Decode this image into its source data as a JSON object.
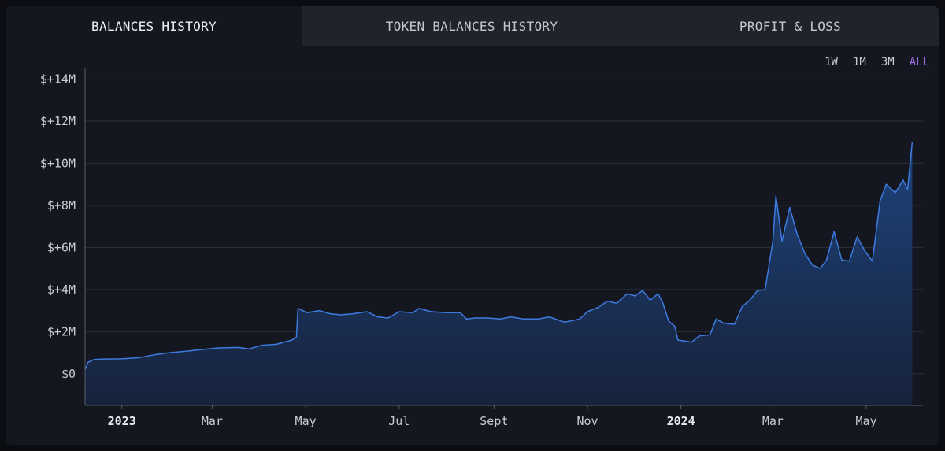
{
  "tabs": [
    {
      "label": "BALANCES HISTORY",
      "active": true
    },
    {
      "label": "TOKEN BALANCES HISTORY",
      "active": false
    },
    {
      "label": "PROFIT & LOSS",
      "active": false
    }
  ],
  "ranges": [
    {
      "label": "1W",
      "selected": false
    },
    {
      "label": "1M",
      "selected": false
    },
    {
      "label": "3M",
      "selected": false
    },
    {
      "label": "ALL",
      "selected": true
    }
  ],
  "colors": {
    "line": "#3d7be0",
    "fill_top": "#1f4680",
    "fill_bottom": "#17233d",
    "accent": "#9a6fe0"
  },
  "chart_data": {
    "type": "area",
    "title": "",
    "xlabel": "",
    "ylabel": "",
    "ylim": [
      -1500000,
      14500000
    ],
    "xlim": [
      "2022-12-08",
      "2024-06-07"
    ],
    "grid": true,
    "y_ticks": [
      {
        "value": 0,
        "label": "$0"
      },
      {
        "value": 2000000,
        "label": "$+2M"
      },
      {
        "value": 4000000,
        "label": "$+4M"
      },
      {
        "value": 6000000,
        "label": "$+6M"
      },
      {
        "value": 8000000,
        "label": "$+8M"
      },
      {
        "value": 10000000,
        "label": "$+10M"
      },
      {
        "value": 12000000,
        "label": "$+12M"
      },
      {
        "value": 14000000,
        "label": "$+14M"
      }
    ],
    "x_ticks": [
      {
        "date": "2023-01-01",
        "label": "2023",
        "bold": true
      },
      {
        "date": "2023-03-01",
        "label": "Mar",
        "bold": false
      },
      {
        "date": "2023-05-01",
        "label": "May",
        "bold": false
      },
      {
        "date": "2023-07-01",
        "label": "Jul",
        "bold": false
      },
      {
        "date": "2023-09-01",
        "label": "Sept",
        "bold": false
      },
      {
        "date": "2023-11-01",
        "label": "Nov",
        "bold": false
      },
      {
        "date": "2024-01-01",
        "label": "2024",
        "bold": true
      },
      {
        "date": "2024-03-01",
        "label": "Mar",
        "bold": false
      },
      {
        "date": "2024-05-01",
        "label": "May",
        "bold": false
      }
    ],
    "series": [
      {
        "points": [
          [
            "2022-12-08",
            200000
          ],
          [
            "2022-12-10",
            550000
          ],
          [
            "2022-12-14",
            680000
          ],
          [
            "2022-12-22",
            700000
          ],
          [
            "2023-01-01",
            710000
          ],
          [
            "2023-01-12",
            760000
          ],
          [
            "2023-01-22",
            900000
          ],
          [
            "2023-02-01",
            1000000
          ],
          [
            "2023-02-12",
            1070000
          ],
          [
            "2023-02-22",
            1150000
          ],
          [
            "2023-03-05",
            1230000
          ],
          [
            "2023-03-18",
            1250000
          ],
          [
            "2023-03-25",
            1180000
          ],
          [
            "2023-04-02",
            1350000
          ],
          [
            "2023-04-12",
            1400000
          ],
          [
            "2023-04-22",
            1600000
          ],
          [
            "2023-04-25",
            1750000
          ],
          [
            "2023-04-26",
            3100000
          ],
          [
            "2023-05-02",
            2900000
          ],
          [
            "2023-05-10",
            3000000
          ],
          [
            "2023-05-17",
            2850000
          ],
          [
            "2023-05-24",
            2800000
          ],
          [
            "2023-06-01",
            2850000
          ],
          [
            "2023-06-10",
            2950000
          ],
          [
            "2023-06-17",
            2700000
          ],
          [
            "2023-06-24",
            2650000
          ],
          [
            "2023-07-01",
            2950000
          ],
          [
            "2023-07-10",
            2900000
          ],
          [
            "2023-07-14",
            3100000
          ],
          [
            "2023-07-22",
            2950000
          ],
          [
            "2023-08-01",
            2900000
          ],
          [
            "2023-08-10",
            2900000
          ],
          [
            "2023-08-14",
            2600000
          ],
          [
            "2023-08-20",
            2650000
          ],
          [
            "2023-08-28",
            2650000
          ],
          [
            "2023-09-05",
            2600000
          ],
          [
            "2023-09-12",
            2700000
          ],
          [
            "2023-09-20",
            2600000
          ],
          [
            "2023-09-30",
            2600000
          ],
          [
            "2023-10-07",
            2700000
          ],
          [
            "2023-10-17",
            2450000
          ],
          [
            "2023-10-27",
            2600000
          ],
          [
            "2023-11-01",
            2950000
          ],
          [
            "2023-11-08",
            3150000
          ],
          [
            "2023-11-14",
            3450000
          ],
          [
            "2023-11-20",
            3350000
          ],
          [
            "2023-11-27",
            3800000
          ],
          [
            "2023-12-02",
            3700000
          ],
          [
            "2023-12-07",
            3950000
          ],
          [
            "2023-12-12",
            3500000
          ],
          [
            "2023-12-17",
            3800000
          ],
          [
            "2023-12-20",
            3400000
          ],
          [
            "2023-12-24",
            2500000
          ],
          [
            "2023-12-28",
            2250000
          ],
          [
            "2023-12-30",
            1600000
          ],
          [
            "2024-01-04",
            1550000
          ],
          [
            "2024-01-08",
            1500000
          ],
          [
            "2024-01-13",
            1800000
          ],
          [
            "2024-01-20",
            1850000
          ],
          [
            "2024-01-24",
            2600000
          ],
          [
            "2024-01-29",
            2400000
          ],
          [
            "2024-02-05",
            2350000
          ],
          [
            "2024-02-10",
            3200000
          ],
          [
            "2024-02-15",
            3500000
          ],
          [
            "2024-02-20",
            3950000
          ],
          [
            "2024-02-25",
            4000000
          ],
          [
            "2024-03-01",
            6300000
          ],
          [
            "2024-03-03",
            8450000
          ],
          [
            "2024-03-07",
            6300000
          ],
          [
            "2024-03-12",
            7900000
          ],
          [
            "2024-03-17",
            6600000
          ],
          [
            "2024-03-22",
            5700000
          ],
          [
            "2024-03-27",
            5150000
          ],
          [
            "2024-04-01",
            5000000
          ],
          [
            "2024-04-05",
            5400000
          ],
          [
            "2024-04-10",
            6750000
          ],
          [
            "2024-04-15",
            5400000
          ],
          [
            "2024-04-20",
            5350000
          ],
          [
            "2024-04-25",
            6500000
          ],
          [
            "2024-04-30",
            5850000
          ],
          [
            "2024-05-05",
            5350000
          ],
          [
            "2024-05-10",
            8200000
          ],
          [
            "2024-05-14",
            9000000
          ],
          [
            "2024-05-20",
            8600000
          ],
          [
            "2024-05-25",
            9200000
          ],
          [
            "2024-05-28",
            8750000
          ],
          [
            "2024-05-31",
            11000000
          ]
        ]
      }
    ]
  }
}
